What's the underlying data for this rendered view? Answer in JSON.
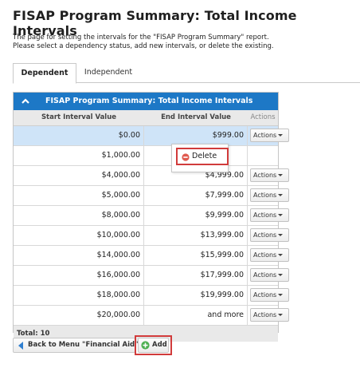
{
  "page": {
    "title": "FISAP Program Summary: Total Income Intervals",
    "description_line1": "The page for setting the intervals for the \"FISAP Program Summary\" report.",
    "description_line2": "Please select a dependency status, add new intervals, or delete the existing."
  },
  "tabs": [
    {
      "label": "Dependent",
      "active": true
    },
    {
      "label": "Independent",
      "active": false
    }
  ],
  "panel": {
    "title": "FISAP Program Summary: Total Income Intervals",
    "header_color": "#1d78c6",
    "columns": {
      "start": "Start Interval Value",
      "end": "End Interval Value",
      "actions": "Actions"
    },
    "rows": [
      {
        "start": "$0.00",
        "end": "$999.00",
        "action": "Actions",
        "selected": true
      },
      {
        "start": "$1,000.00",
        "end": "",
        "action": ""
      },
      {
        "start": "$4,000.00",
        "end": "$4,999.00",
        "action": "Actions"
      },
      {
        "start": "$5,000.00",
        "end": "$7,999.00",
        "action": "Actions"
      },
      {
        "start": "$8,000.00",
        "end": "$9,999.00",
        "action": "Actions"
      },
      {
        "start": "$10,000.00",
        "end": "$13,999.00",
        "action": "Actions"
      },
      {
        "start": "$14,000.00",
        "end": "$15,999.00",
        "action": "Actions"
      },
      {
        "start": "$16,000.00",
        "end": "$17,999.00",
        "action": "Actions"
      },
      {
        "start": "$18,000.00",
        "end": "$19,999.00",
        "action": "Actions"
      },
      {
        "start": "$20,000.00",
        "end": "and more",
        "action": "Actions"
      }
    ],
    "total": "Total: 10"
  },
  "dropdown": {
    "delete_label": "Delete",
    "highlight_color": "#d13b3b"
  },
  "bottom": {
    "back_label": "Back to Menu \"Financial Aid\"",
    "add_label": "Add"
  },
  "icons": {
    "collapse": "chevron-up-icon",
    "delete": "delete-icon",
    "back": "back-arrow-icon",
    "add": "add-icon"
  }
}
